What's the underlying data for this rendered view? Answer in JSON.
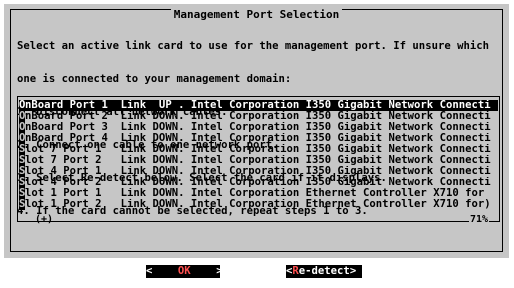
{
  "dialog": {
    "title": "Management Port Selection",
    "instructions": [
      "Select an active link card to use for the management port. If unsure which",
      "one is connected to your management domain:",
      "1. Disconnect all network cables.",
      "2. Connect one cable to one network port.",
      "3. Select Re-detect below. Select the card if it displays.",
      "4. If the card cannot be selected, repeat steps 1 to 3."
    ]
  },
  "ports": [
    {
      "mark": "O",
      "text": "nBoard Port 1  Link  UP . Intel Corporation I350 Gigabit Network Connecti",
      "selected": true
    },
    {
      "mark": "O",
      "text": "nBoard Port 2  Link DOWN. Intel Corporation I350 Gigabit Network Connecti",
      "selected": false
    },
    {
      "mark": "O",
      "text": "nBoard Port 3  Link DOWN. Intel Corporation I350 Gigabit Network Connecti",
      "selected": false
    },
    {
      "mark": "O",
      "text": "nBoard Port 4  Link DOWN. Intel Corporation I350 Gigabit Network Connecti",
      "selected": false
    },
    {
      "mark": "S",
      "text": "lot 7 Port 1   Link DOWN. Intel Corporation I350 Gigabit Network Connecti",
      "selected": false
    },
    {
      "mark": "S",
      "text": "lot 7 Port 2   Link DOWN. Intel Corporation I350 Gigabit Network Connecti",
      "selected": false
    },
    {
      "mark": "S",
      "text": "lot 4 Port 1   Link DOWN. Intel Corporation I350 Gigabit Network Connecti",
      "selected": false
    },
    {
      "mark": "S",
      "text": "lot 4 Port 2   Link DOWN. Intel Corporation I350 Gigabit Network Connecti",
      "selected": false
    },
    {
      "mark": "S",
      "text": "lot 1 Port 1   Link DOWN. Intel Corporation Ethernet Controller X710 for",
      "selected": false
    },
    {
      "mark": "S",
      "text": "lot 1 Port 2   Link DOWN. Intel Corporation Ethernet Controller X710 for)",
      "selected": false
    }
  ],
  "list_footer": {
    "scroll_indicator": "(+)",
    "percent": "71%"
  },
  "buttons": {
    "ok": {
      "left": "<",
      "label": "OK",
      "right": ">"
    },
    "redetect": {
      "left": "<",
      "hot": "R",
      "label": "e-detect",
      "right": ">"
    }
  },
  "colors": {
    "dialog_bg": "#c6c6c6",
    "text": "#000000",
    "hotkey": "#ff5050"
  }
}
